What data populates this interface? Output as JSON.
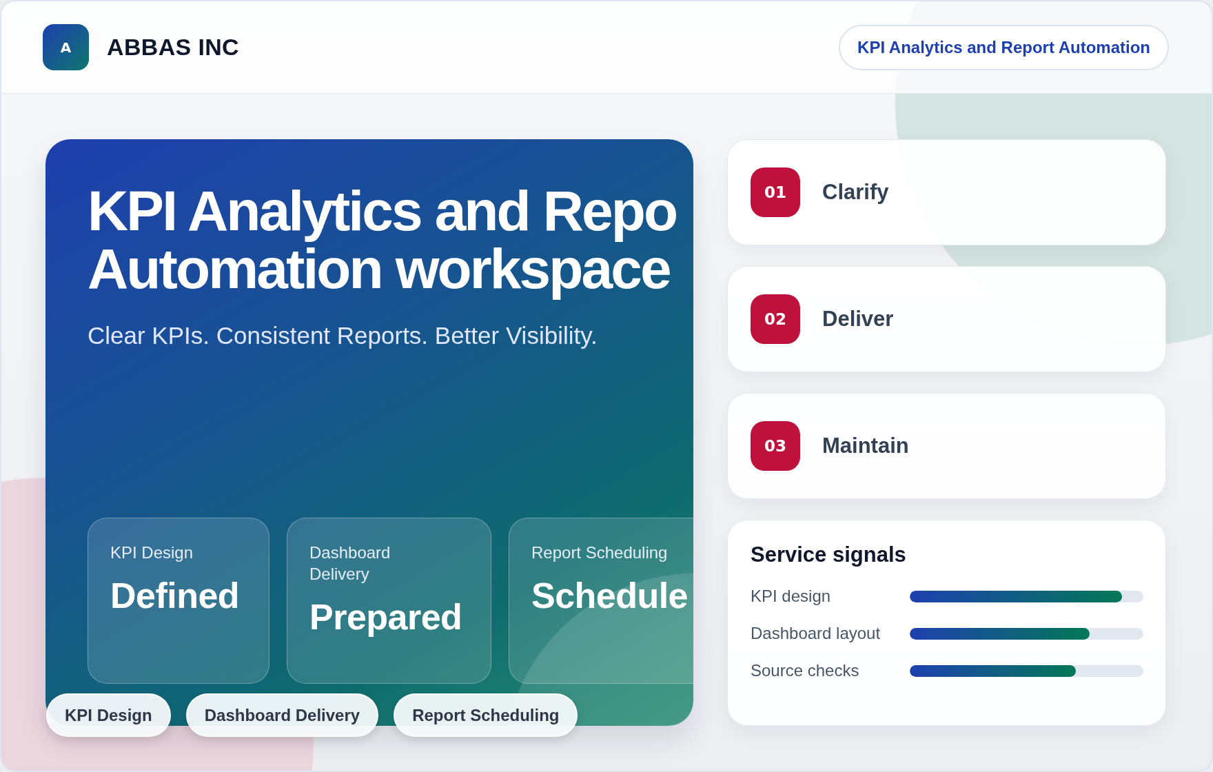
{
  "header": {
    "brand_mark": "A",
    "brand": "ABBAS INC",
    "pill": "KPI Analytics and Report Automation"
  },
  "hero": {
    "title_lines": [
      "KPI Analytics and Repo",
      "Automation workspace"
    ],
    "subtitle": "Clear KPIs. Consistent Reports. Better Visibility.",
    "tiles": [
      {
        "label": "KPI Design",
        "value": "Defined"
      },
      {
        "label": "Dashboard Delivery",
        "value": "Prepared"
      },
      {
        "label": "Report Scheduling",
        "value": "Schedule"
      }
    ],
    "chips": [
      "KPI Design",
      "Dashboard Delivery",
      "Report Scheduling"
    ]
  },
  "steps": [
    {
      "number": "01",
      "title": "Clarify"
    },
    {
      "number": "02",
      "title": "Deliver"
    },
    {
      "number": "03",
      "title": "Maintain"
    }
  ],
  "signals": {
    "title": "Service signals",
    "rows": [
      {
        "label": "KPI design",
        "level": 0.91
      },
      {
        "label": "Dashboard layout",
        "level": 0.77
      },
      {
        "label": "Source checks",
        "level": 0.71
      }
    ]
  }
}
